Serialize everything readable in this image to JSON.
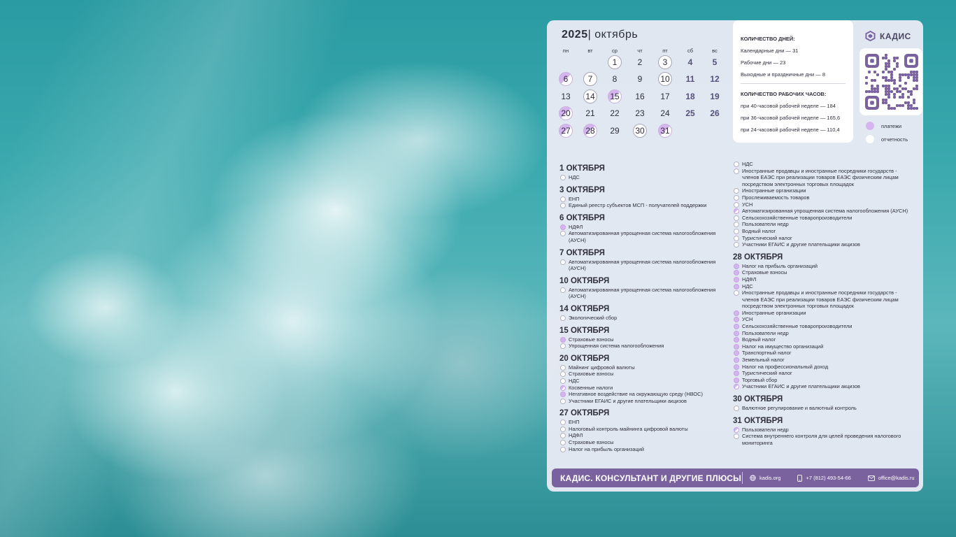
{
  "calendar": {
    "year": "2025",
    "sep": "|",
    "month": "октябрь",
    "weekdays": [
      "пн",
      "вт",
      "ср",
      "чт",
      "пт",
      "сб",
      "вс"
    ],
    "days": [
      {
        "d": "1",
        "col": 2,
        "row": 0,
        "style": "ring"
      },
      {
        "d": "2",
        "col": 3,
        "row": 0,
        "style": ""
      },
      {
        "d": "3",
        "col": 4,
        "row": 0,
        "style": "ring"
      },
      {
        "d": "4",
        "col": 5,
        "row": 0,
        "style": "weekend"
      },
      {
        "d": "5",
        "col": 6,
        "row": 0,
        "style": "weekend"
      },
      {
        "d": "6",
        "col": 0,
        "row": 1,
        "style": "half"
      },
      {
        "d": "7",
        "col": 1,
        "row": 1,
        "style": "ring"
      },
      {
        "d": "8",
        "col": 2,
        "row": 1,
        "style": ""
      },
      {
        "d": "9",
        "col": 3,
        "row": 1,
        "style": ""
      },
      {
        "d": "10",
        "col": 4,
        "row": 1,
        "style": "ring"
      },
      {
        "d": "11",
        "col": 5,
        "row": 1,
        "style": "weekend"
      },
      {
        "d": "12",
        "col": 6,
        "row": 1,
        "style": "weekend"
      },
      {
        "d": "13",
        "col": 0,
        "row": 2,
        "style": ""
      },
      {
        "d": "14",
        "col": 1,
        "row": 2,
        "style": "ring"
      },
      {
        "d": "15",
        "col": 2,
        "row": 2,
        "style": "half"
      },
      {
        "d": "16",
        "col": 3,
        "row": 2,
        "style": ""
      },
      {
        "d": "17",
        "col": 4,
        "row": 2,
        "style": ""
      },
      {
        "d": "18",
        "col": 5,
        "row": 2,
        "style": "weekend"
      },
      {
        "d": "19",
        "col": 6,
        "row": 2,
        "style": "weekend"
      },
      {
        "d": "20",
        "col": 0,
        "row": 3,
        "style": "half"
      },
      {
        "d": "21",
        "col": 1,
        "row": 3,
        "style": ""
      },
      {
        "d": "22",
        "col": 2,
        "row": 3,
        "style": ""
      },
      {
        "d": "23",
        "col": 3,
        "row": 3,
        "style": ""
      },
      {
        "d": "24",
        "col": 4,
        "row": 3,
        "style": ""
      },
      {
        "d": "25",
        "col": 5,
        "row": 3,
        "style": "weekend"
      },
      {
        "d": "26",
        "col": 6,
        "row": 3,
        "style": "weekend"
      },
      {
        "d": "27",
        "col": 0,
        "row": 4,
        "style": "half"
      },
      {
        "d": "28",
        "col": 1,
        "row": 4,
        "style": "half"
      },
      {
        "d": "29",
        "col": 2,
        "row": 4,
        "style": ""
      },
      {
        "d": "30",
        "col": 3,
        "row": 4,
        "style": "ring"
      },
      {
        "d": "31",
        "col": 4,
        "row": 4,
        "style": "half"
      }
    ]
  },
  "stats": {
    "days_header": "КОЛИЧЕСТВО ДНЕЙ:",
    "calendar_days": "Календарные дни — 31",
    "work_days": "Рабочие дни — 23",
    "off_days": "Выходные и праздничные дни — 8",
    "hours_header": "КОЛИЧЕСТВО РАБОЧИХ ЧАСОВ:",
    "h40": "при 40-часовой рабочей неделе — 184",
    "h36": "при 36-часовой рабочей неделе — 165,6",
    "h24": "при 24-часовой рабочей неделе — 110,4"
  },
  "logo": {
    "text": "КАДИС"
  },
  "legend": {
    "payments": "платежи",
    "reports": "отчетность"
  },
  "colors": {
    "accent": "#7a629f",
    "payment": "#d6b4ef",
    "ring": "#a6a6b6"
  },
  "left_col": [
    {
      "date": "1 ОКТЯБРЯ",
      "items": [
        {
          "t": "НДС",
          "k": "r"
        }
      ]
    },
    {
      "date": "3 ОКТЯБРЯ",
      "items": [
        {
          "t": "ЕНП",
          "k": "r"
        },
        {
          "t": "Единый реестр субъектов МСП - получателей поддержки",
          "k": "r"
        }
      ]
    },
    {
      "date": "6 ОКТЯБРЯ",
      "items": [
        {
          "t": "НДФЛ",
          "k": "p"
        },
        {
          "t": "Автоматизированная упрощенная система налогообложения (АУСН)",
          "k": "r"
        }
      ]
    },
    {
      "date": "7 ОКТЯБРЯ",
      "items": [
        {
          "t": "Автоматизированная упрощенная система налогообложения (АУСН)",
          "k": "r"
        }
      ]
    },
    {
      "date": "10 ОКТЯБРЯ",
      "items": [
        {
          "t": "Автоматизированная упрощенная система налогообложения (АУСН)",
          "k": "r"
        }
      ]
    },
    {
      "date": "14 ОКТЯБРЯ",
      "items": [
        {
          "t": "Экологический сбор",
          "k": "r"
        }
      ]
    },
    {
      "date": "15 ОКТЯБРЯ",
      "items": [
        {
          "t": "Страховые взносы",
          "k": "p"
        },
        {
          "t": "Упрощенная система налогообложения",
          "k": "r"
        }
      ]
    },
    {
      "date": "20 ОКТЯБРЯ",
      "items": [
        {
          "t": "Майнинг цифровой валюты",
          "k": "r"
        },
        {
          "t": "Страховые взносы",
          "k": "r"
        },
        {
          "t": "НДС",
          "k": "r"
        },
        {
          "t": "Косвенные налоги",
          "k": "h"
        },
        {
          "t": "Негативное воздействие на окружающую среду (НВОС)",
          "k": "p"
        },
        {
          "t": "Участники ЕГАИС и другие плательщики акцизов",
          "k": "r"
        }
      ]
    },
    {
      "date": "27 ОКТЯБРЯ",
      "items": [
        {
          "t": "ЕНП",
          "k": "r"
        },
        {
          "t": "Налоговый контроль майнинга цифровой валюты",
          "k": "r"
        },
        {
          "t": "НДФЛ",
          "k": "r"
        },
        {
          "t": "Страховые взносы",
          "k": "r"
        },
        {
          "t": "Налог на прибыль организаций",
          "k": "r"
        }
      ]
    }
  ],
  "right_col": [
    {
      "date": "",
      "items": [
        {
          "t": "НДС",
          "k": "r"
        },
        {
          "t": "Иностранные продавцы и иностранные посредники государств - членов ЕАЭС при реализации товаров ЕАЭС физическим лицам посредством электронных торговых площадок",
          "k": "r"
        },
        {
          "t": "Иностранные организации",
          "k": "r"
        },
        {
          "t": "Прослеживаемость товаров",
          "k": "r"
        },
        {
          "t": "УСН",
          "k": "r"
        },
        {
          "t": "Автоматизированная упрощенная система налогообложения (АУСН)",
          "k": "h"
        },
        {
          "t": "Сельскохозяйственные товаропроизводители",
          "k": "r"
        },
        {
          "t": "Пользователи недр",
          "k": "r"
        },
        {
          "t": "Водный налог",
          "k": "r"
        },
        {
          "t": "Туристический налог",
          "k": "r"
        },
        {
          "t": "Участники ЕГАИС и другие плательщики акцизов",
          "k": "r"
        }
      ]
    },
    {
      "date": "28 ОКТЯБРЯ",
      "items": [
        {
          "t": "Налог на прибыль организаций",
          "k": "p"
        },
        {
          "t": "Страховые взносы",
          "k": "p"
        },
        {
          "t": "НДФЛ",
          "k": "p"
        },
        {
          "t": "НДС",
          "k": "p"
        },
        {
          "t": "Иностранные продавцы и иностранные посредники государств - членов ЕАЭС при реализации товаров ЕАЭС физическим лицам посредством электронных торговых площадок",
          "k": "r"
        },
        {
          "t": "Иностранные организации",
          "k": "p"
        },
        {
          "t": "УСН",
          "k": "p"
        },
        {
          "t": "Сельскохозяйственные товаропроизводители",
          "k": "p"
        },
        {
          "t": "Пользователи недр",
          "k": "p"
        },
        {
          "t": "Водный налог",
          "k": "p"
        },
        {
          "t": "Налог на имущество организаций",
          "k": "p"
        },
        {
          "t": "Транспортный налог",
          "k": "p"
        },
        {
          "t": "Земельный налог",
          "k": "p"
        },
        {
          "t": "Налог на профессиональный доход",
          "k": "p"
        },
        {
          "t": "Туристический налог",
          "k": "p"
        },
        {
          "t": "Торговый сбор",
          "k": "p"
        },
        {
          "t": "Участники ЕГАИС и другие плательщики акцизов",
          "k": "h"
        }
      ]
    },
    {
      "date": "30 ОКТЯБРЯ",
      "items": [
        {
          "t": "Валютное регулирование и валютный контроль",
          "k": "r"
        }
      ]
    },
    {
      "date": "31 ОКТЯБРЯ",
      "items": [
        {
          "t": "Пользователи недр",
          "k": "h"
        },
        {
          "t": "Система внутреннего контроля для целей проведения налогового мониторинга",
          "k": "r"
        }
      ]
    }
  ],
  "footer": {
    "title": "КАДИС. КОНСУЛЬТАНТ И ДРУГИЕ ПЛЮСЫ",
    "site": "kadis.org",
    "phone": "+7 (812) 493-54-66",
    "email": "office@kadis.ru"
  }
}
